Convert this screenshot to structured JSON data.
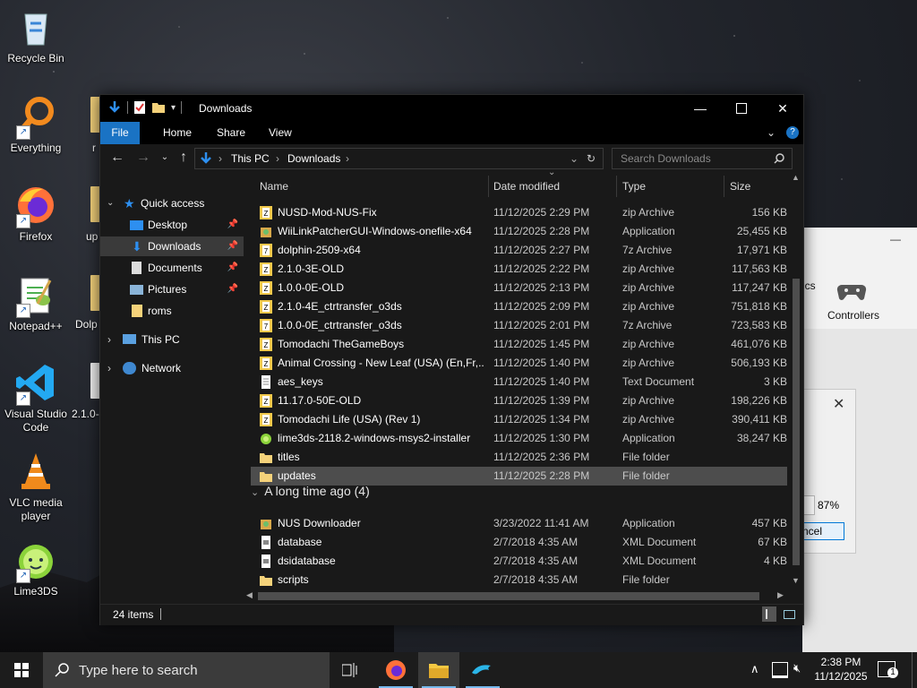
{
  "desktop": {
    "icons": [
      {
        "label": "Recycle Bin"
      },
      {
        "label": "Everything"
      },
      {
        "label": "Firefox"
      },
      {
        "label": "Notepad++"
      },
      {
        "label": "Visual Studio Code"
      },
      {
        "label": "VLC media player"
      },
      {
        "label": "Lime3DS"
      }
    ],
    "partial_labels": [
      "r",
      "up",
      "Dolp",
      "2.1.0-"
    ]
  },
  "background_windows": {
    "settings": {
      "item_label": "Controllers",
      "cut_label": "ics"
    },
    "dialog": {
      "percent": "87%",
      "cancel_label": "ncel"
    }
  },
  "explorer": {
    "title": "Downloads",
    "ribbon_tabs": [
      "File",
      "Home",
      "Share",
      "View"
    ],
    "address": {
      "root": "This PC",
      "folder": "Downloads"
    },
    "search_placeholder": "Search Downloads",
    "nav": {
      "quick_access": "Quick access",
      "items": [
        "Desktop",
        "Downloads",
        "Documents",
        "Pictures",
        "roms"
      ],
      "this_pc": "This PC",
      "network": "Network"
    },
    "columns": [
      "Name",
      "Date modified",
      "Type",
      "Size"
    ],
    "files": [
      {
        "name": "NUSD-Mod-NUS-Fix",
        "date": "11/12/2025 2:29 PM",
        "type": "zip Archive",
        "size": "156 KB",
        "icon": "zip"
      },
      {
        "name": "WiiLinkPatcherGUI-Windows-onefile-x64",
        "date": "11/12/2025 2:28 PM",
        "type": "Application",
        "size": "25,455 KB",
        "icon": "app"
      },
      {
        "name": "dolphin-2509-x64",
        "date": "11/12/2025 2:27 PM",
        "type": "7z Archive",
        "size": "17,971 KB",
        "icon": "7z"
      },
      {
        "name": "2.1.0-3E-OLD",
        "date": "11/12/2025 2:22 PM",
        "type": "zip Archive",
        "size": "117,563 KB",
        "icon": "zip"
      },
      {
        "name": "1.0.0-0E-OLD",
        "date": "11/12/2025 2:13 PM",
        "type": "zip Archive",
        "size": "117,247 KB",
        "icon": "zip"
      },
      {
        "name": "2.1.0-4E_ctrtransfer_o3ds",
        "date": "11/12/2025 2:09 PM",
        "type": "zip Archive",
        "size": "751,818 KB",
        "icon": "zip"
      },
      {
        "name": "1.0.0-0E_ctrtransfer_o3ds",
        "date": "11/12/2025 2:01 PM",
        "type": "7z Archive",
        "size": "723,583 KB",
        "icon": "7z"
      },
      {
        "name": "Tomodachi TheGameBoys",
        "date": "11/12/2025 1:45 PM",
        "type": "zip Archive",
        "size": "461,076 KB",
        "icon": "zip"
      },
      {
        "name": "Animal Crossing - New Leaf (USA) (En,Fr,...",
        "date": "11/12/2025 1:40 PM",
        "type": "zip Archive",
        "size": "506,193 KB",
        "icon": "zip"
      },
      {
        "name": "aes_keys",
        "date": "11/12/2025 1:40 PM",
        "type": "Text Document",
        "size": "3 KB",
        "icon": "txt"
      },
      {
        "name": "11.17.0-50E-OLD",
        "date": "11/12/2025 1:39 PM",
        "type": "zip Archive",
        "size": "198,226 KB",
        "icon": "zip"
      },
      {
        "name": "Tomodachi Life (USA) (Rev 1)",
        "date": "11/12/2025 1:34 PM",
        "type": "zip Archive",
        "size": "390,411 KB",
        "icon": "zip"
      },
      {
        "name": "lime3ds-2118.2-windows-msys2-installer",
        "date": "11/12/2025 1:30 PM",
        "type": "Application",
        "size": "38,247 KB",
        "icon": "lime"
      },
      {
        "name": "titles",
        "date": "11/12/2025 2:36 PM",
        "type": "File folder",
        "size": "",
        "icon": "folder"
      },
      {
        "name": "updates",
        "date": "11/12/2025 2:28 PM",
        "type": "File folder",
        "size": "",
        "icon": "folder",
        "selected": true
      }
    ],
    "group_label": "A long time ago (4)",
    "old_files": [
      {
        "name": "NUS Downloader",
        "date": "3/23/2022 11:41 AM",
        "type": "Application",
        "size": "457 KB",
        "icon": "app"
      },
      {
        "name": "database",
        "date": "2/7/2018 4:35 AM",
        "type": "XML Document",
        "size": "67 KB",
        "icon": "xml"
      },
      {
        "name": "dsidatabase",
        "date": "2/7/2018 4:35 AM",
        "type": "XML Document",
        "size": "4 KB",
        "icon": "xml"
      },
      {
        "name": "scripts",
        "date": "2/7/2018 4:35 AM",
        "type": "File folder",
        "size": "",
        "icon": "folder"
      }
    ],
    "status": "24 items"
  },
  "taskbar": {
    "search_placeholder": "Type here to search",
    "time": "2:38 PM",
    "date": "11/12/2025",
    "notification_count": "1"
  },
  "colors": {
    "accent": "#1a73c4",
    "zip": "#f2c94c",
    "folder": "#f5d27a"
  }
}
